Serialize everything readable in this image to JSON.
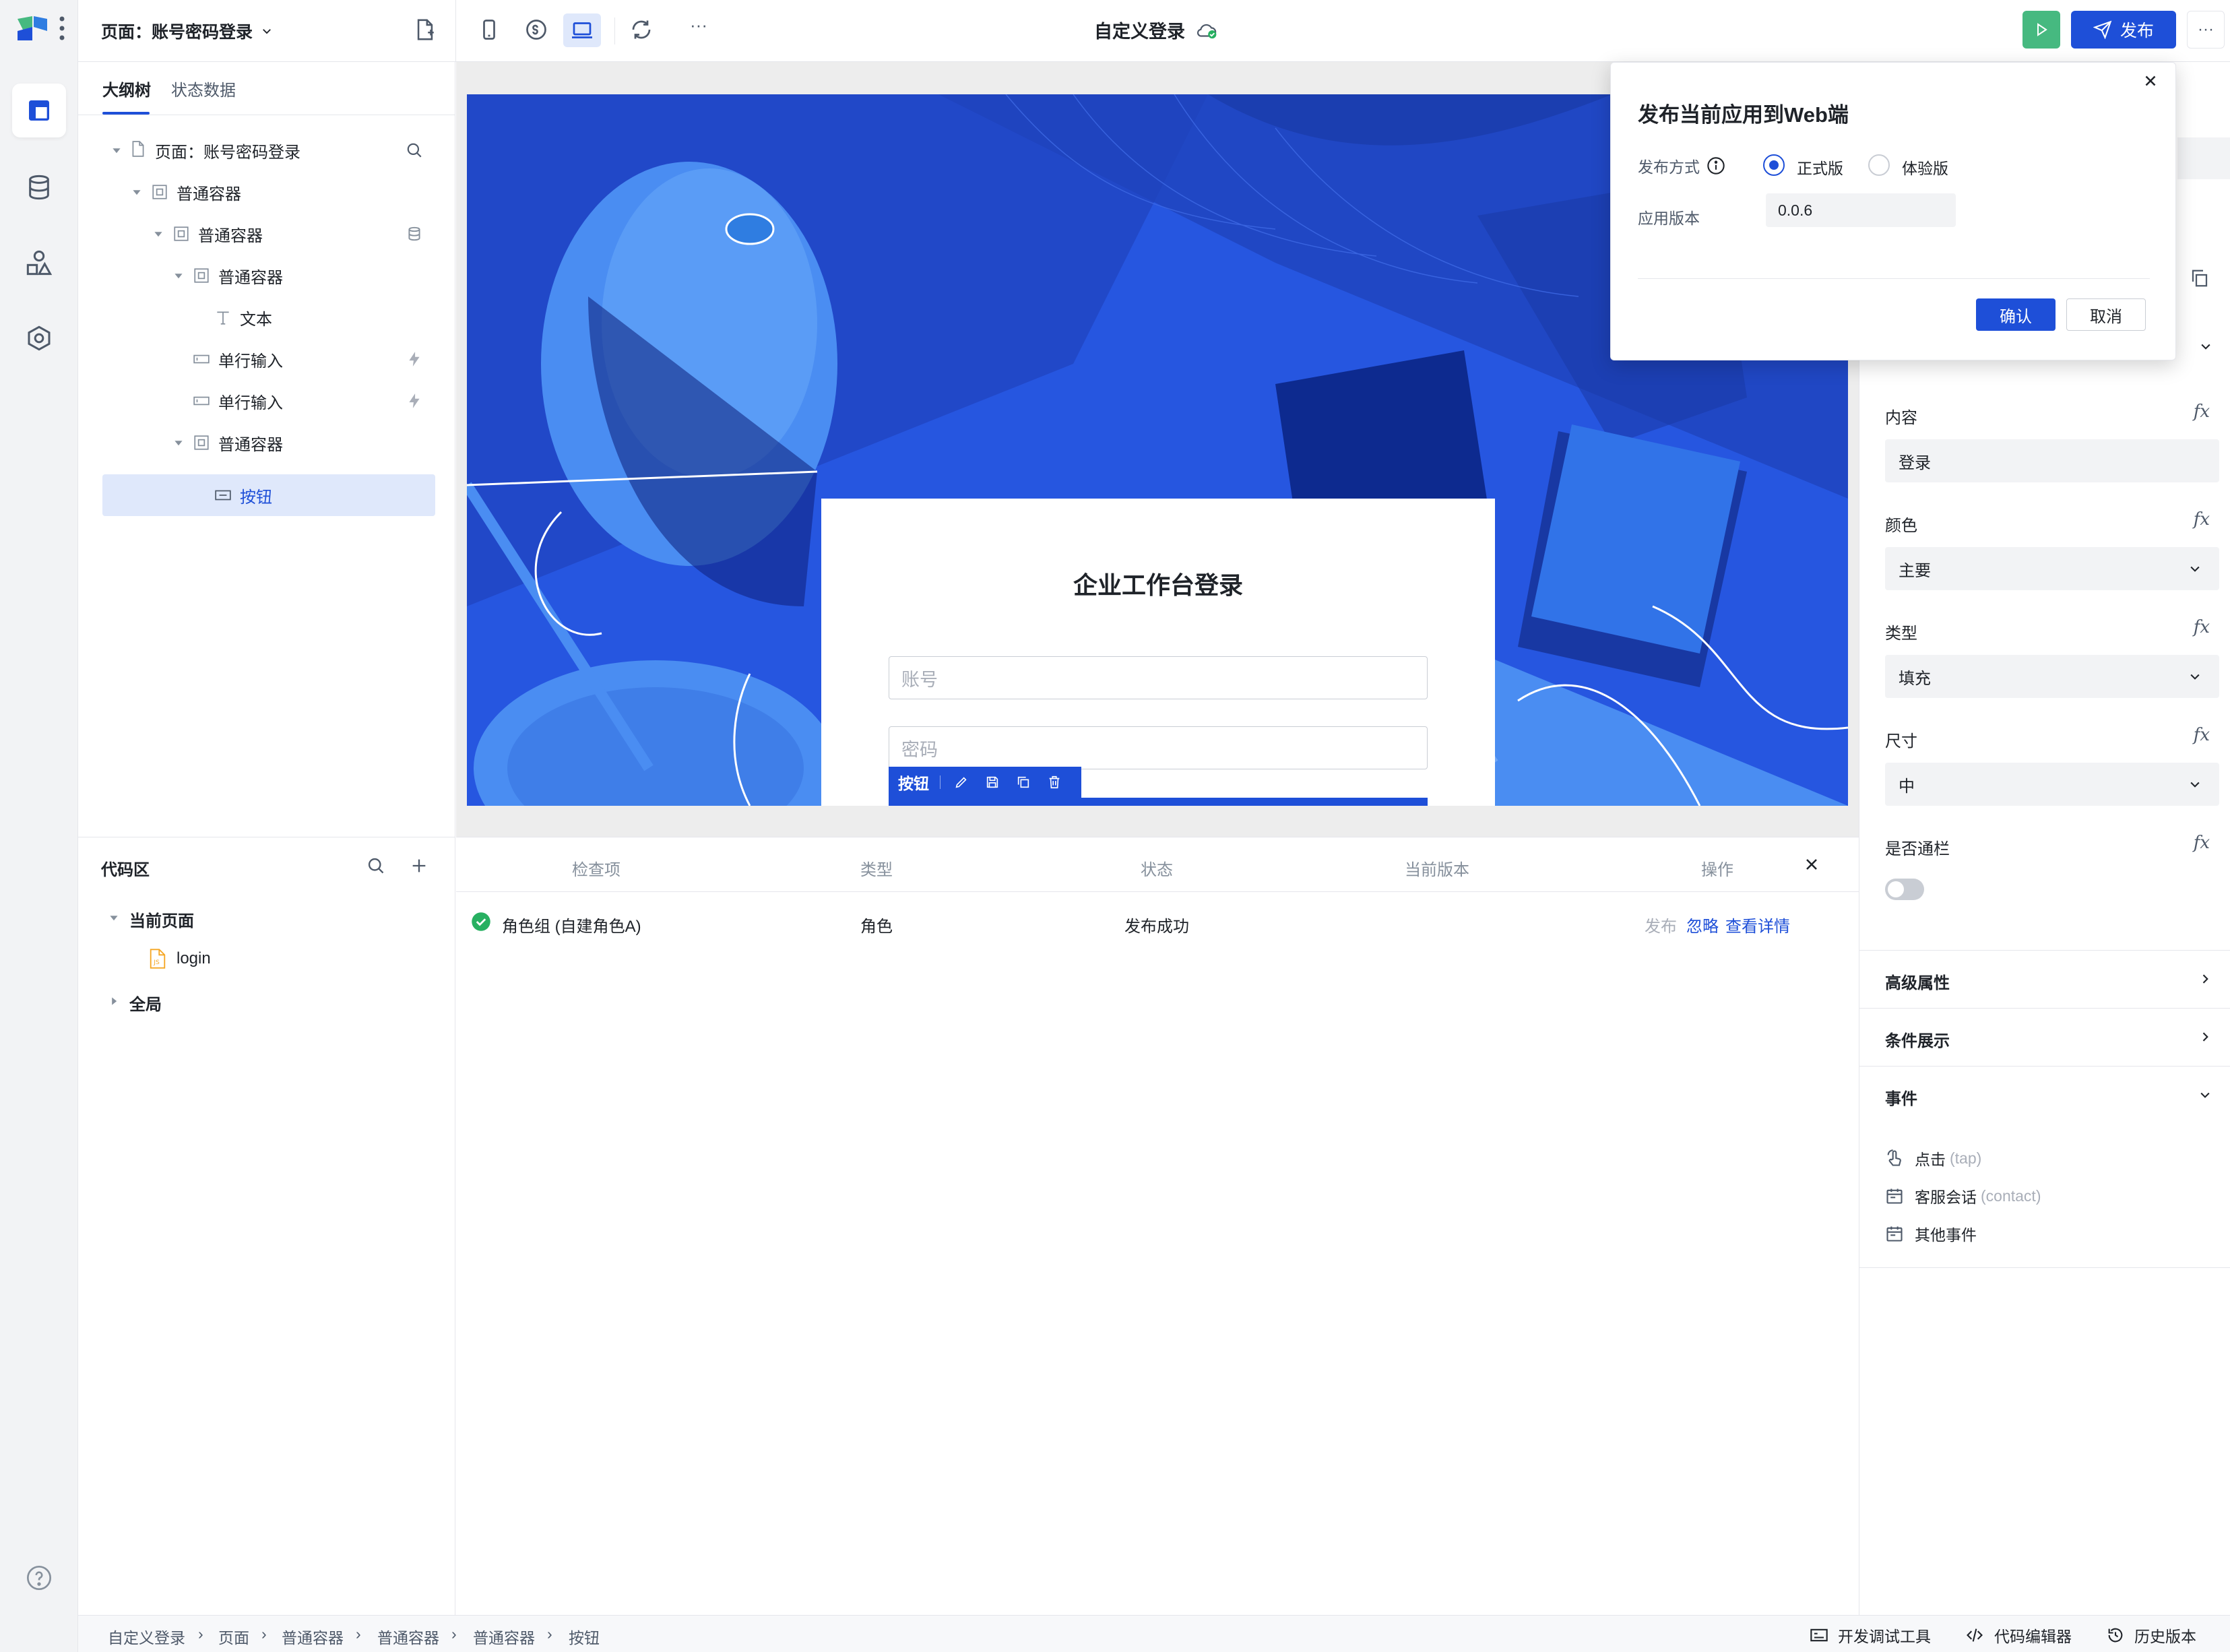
{
  "topbar": {
    "page_selector": "页面：账号密码登录",
    "app_title": "自定义登录",
    "publish_label": "发布",
    "more": "···"
  },
  "left_panel": {
    "tabs": [
      {
        "label": "大纲树",
        "active": true
      },
      {
        "label": "状态数据",
        "active": false
      }
    ],
    "tree": [
      {
        "label": "页面：账号密码登录",
        "icon": "page-icon",
        "depth": 0
      },
      {
        "label": "普通容器",
        "icon": "container-icon",
        "depth": 1
      },
      {
        "label": "普通容器",
        "icon": "container-icon",
        "depth": 2
      },
      {
        "label": "普通容器",
        "icon": "container-icon",
        "depth": 3
      },
      {
        "label": "文本",
        "icon": "text-icon",
        "depth": 4
      },
      {
        "label": "单行输入",
        "icon": "input-icon",
        "depth": 3
      },
      {
        "label": "单行输入",
        "icon": "input-icon",
        "depth": 3
      },
      {
        "label": "普通容器",
        "icon": "container-icon",
        "depth": 3
      },
      {
        "label": "按钮",
        "icon": "button-icon",
        "depth": 4,
        "selected": true
      }
    ]
  },
  "code_area": {
    "title": "代码区",
    "current_page": "当前页面",
    "file": "login",
    "global": "全局"
  },
  "canvas": {
    "login_title": "企业工作台登录",
    "account_placeholder": "账号",
    "password_placeholder": "密码",
    "selected_tag": "按钮"
  },
  "check_panel": {
    "columns": [
      "检查项",
      "类型",
      "状态",
      "当前版本",
      "操作"
    ],
    "rows": [
      {
        "item": "角色组 (自建角色A)",
        "type": "角色",
        "status": "发布成功",
        "version": "",
        "actions": [
          "发布",
          "忽略",
          "查看详情"
        ]
      }
    ]
  },
  "properties": {
    "content_label": "内容",
    "content_value": "登录",
    "color_label": "颜色",
    "color_value": "主要",
    "type_label": "类型",
    "type_value": "填充",
    "size_label": "尺寸",
    "size_value": "中",
    "full_width_label": "是否通栏",
    "full_width_on": false,
    "fx": "fx",
    "advanced": "高级属性",
    "conditional": "条件展示",
    "events_title": "事件",
    "events": [
      {
        "label": "点击",
        "hint": "(tap)",
        "icon": "tap-icon"
      },
      {
        "label": "客服会话",
        "hint": "(contact)",
        "icon": "calendar-icon"
      },
      {
        "label": "其他事件",
        "hint": "",
        "icon": "calendar-icon"
      }
    ]
  },
  "dialog": {
    "title": "发布当前应用到Web端",
    "method_label": "发布方式",
    "options": [
      {
        "label": "正式版",
        "checked": true
      },
      {
        "label": "体验版",
        "checked": false
      }
    ],
    "version_label": "应用版本",
    "version_value": "0.0.6",
    "confirm": "确认",
    "cancel": "取消"
  },
  "statusbar": {
    "breadcrumb": [
      "自定义登录",
      "页面",
      "普通容器",
      "普通容器",
      "普通容器",
      "按钮"
    ],
    "tools": [
      "开发调试工具",
      "代码编辑器",
      "历史版本"
    ]
  },
  "colors": {
    "accent": "#1e4fd8",
    "success": "#27b061",
    "run": "#46b980",
    "stage": "#2656e0"
  }
}
